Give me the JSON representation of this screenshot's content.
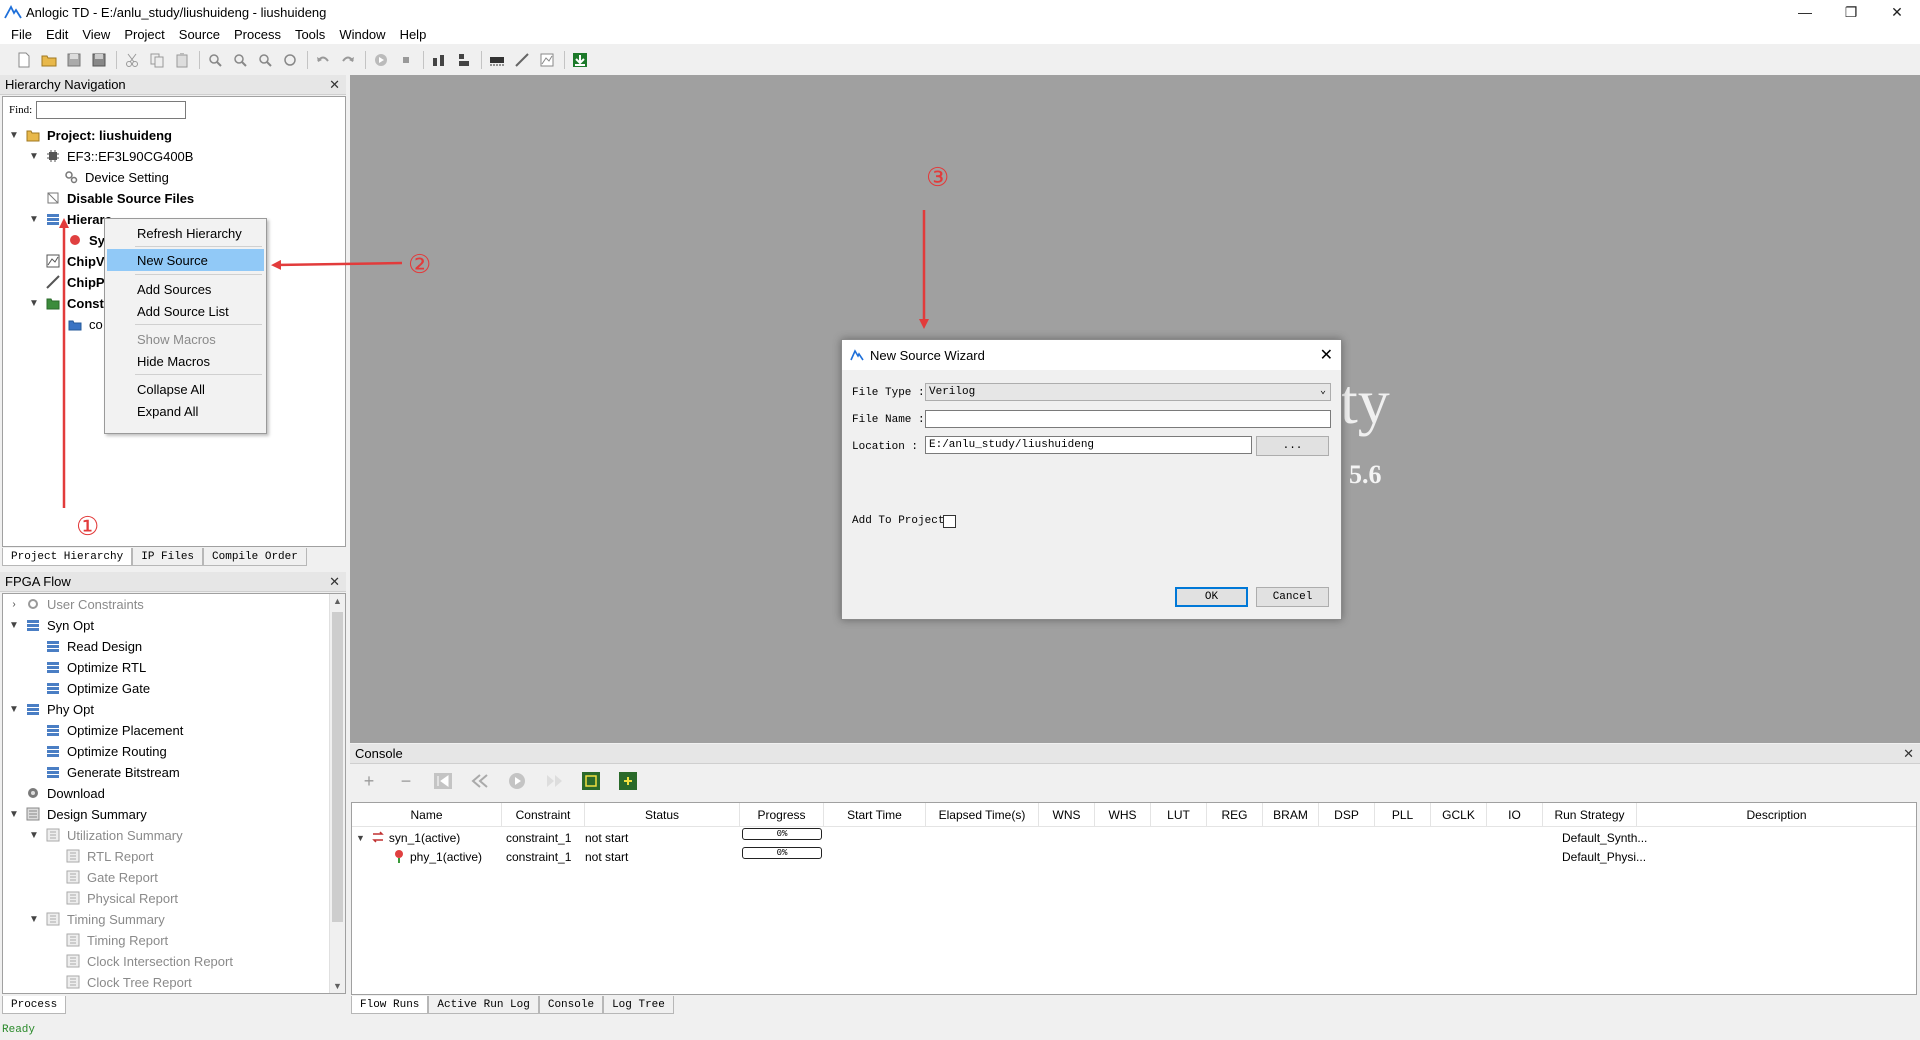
{
  "window": {
    "title": "Anlogic TD - E:/anlu_study/liushuideng - liushuideng",
    "controls": [
      "—",
      "❐",
      "✕"
    ]
  },
  "menu": [
    "File",
    "Edit",
    "View",
    "Project",
    "Source",
    "Process",
    "Tools",
    "Window",
    "Help"
  ],
  "hierarchy": {
    "title": "Hierarchy Navigation",
    "find_label": "Find:",
    "items": [
      {
        "label": "Project: liushuideng",
        "icon": "folder-icon"
      },
      {
        "label": "EF3::EF3L90CG400B",
        "icon": "chip-icon"
      },
      {
        "label": "Device Setting",
        "icon": "gear-icon"
      },
      {
        "label": "Disable Source Files",
        "icon": "disable-icon"
      },
      {
        "label": "Hierarc",
        "icon": "hierarchy-icon"
      },
      {
        "label": "Sy",
        "icon": "verilog-icon"
      },
      {
        "label": "ChipV",
        "icon": "chipwatcher-icon"
      },
      {
        "label": "ChipP",
        "icon": "chipprobe-icon"
      },
      {
        "label": "Const",
        "icon": "constraint-folder-icon"
      },
      {
        "label": "co",
        "icon": "constraint-file-icon"
      }
    ],
    "tabs": [
      "Project Hierarchy",
      "IP Files",
      "Compile Order"
    ]
  },
  "context_menu": {
    "items": [
      "Refresh Hierarchy",
      "New Source",
      "Add Sources",
      "Add Source List",
      "Show Macros",
      "Hide Macros",
      "Collapse All",
      "Expand All"
    ]
  },
  "fpga_flow": {
    "title": "FPGA Flow",
    "items": [
      {
        "label": "User Constraints"
      },
      {
        "label": "Syn Opt"
      },
      {
        "label": "Read Design"
      },
      {
        "label": "Optimize RTL"
      },
      {
        "label": "Optimize Gate"
      },
      {
        "label": "Phy Opt"
      },
      {
        "label": "Optimize Placement"
      },
      {
        "label": "Optimize Routing"
      },
      {
        "label": "Generate Bitstream"
      },
      {
        "label": "Download"
      },
      {
        "label": "Design Summary"
      },
      {
        "label": "Utilization Summary"
      },
      {
        "label": "RTL Report"
      },
      {
        "label": "Gate Report"
      },
      {
        "label": "Physical Report"
      },
      {
        "label": "Timing Summary"
      },
      {
        "label": "Timing Report"
      },
      {
        "label": "Clock Intersection Report"
      },
      {
        "label": "Clock Tree Report"
      }
    ],
    "tabs": [
      "Process"
    ]
  },
  "background": {
    "text1": "ty",
    "text2": "5.6"
  },
  "dialog": {
    "title": "New Source Wizard",
    "file_type_label": "File Type :",
    "file_type_value": "Verilog",
    "file_name_label": "File Name :",
    "file_name_value": "",
    "location_label": "Location :",
    "location_value": "E:/anlu_study/liushuideng",
    "browse_label": "...",
    "add_to_project_label": "Add To Project",
    "add_to_project_checked": false,
    "ok_label": "OK",
    "cancel_label": "Cancel"
  },
  "console": {
    "title": "Console",
    "columns": [
      "Name",
      "Constraint",
      "Status",
      "Progress",
      "Start Time",
      "Elapsed Time(s)",
      "WNS",
      "WHS",
      "LUT",
      "REG",
      "BRAM",
      "DSP",
      "PLL",
      "GCLK",
      "IO",
      "Run Strategy",
      "Description"
    ],
    "rows": [
      {
        "name": "syn_1(active)",
        "constraint": "constraint_1",
        "status": "not start",
        "progress": "0%",
        "strategy": "Default_Synth..."
      },
      {
        "name": "phy_1(active)",
        "constraint": "constraint_1",
        "status": "not start",
        "progress": "0%",
        "strategy": "Default_Physi..."
      }
    ],
    "tabs": [
      "Flow Runs",
      "Active Run Log",
      "Console",
      "Log Tree"
    ]
  },
  "status": {
    "text": "Ready"
  },
  "annotations": [
    "①",
    "②",
    "③"
  ],
  "colors": {
    "accent_highlight": "#91c9f7",
    "annotation_red": "#e23b3b",
    "main_bg": "#a0a0a0"
  }
}
